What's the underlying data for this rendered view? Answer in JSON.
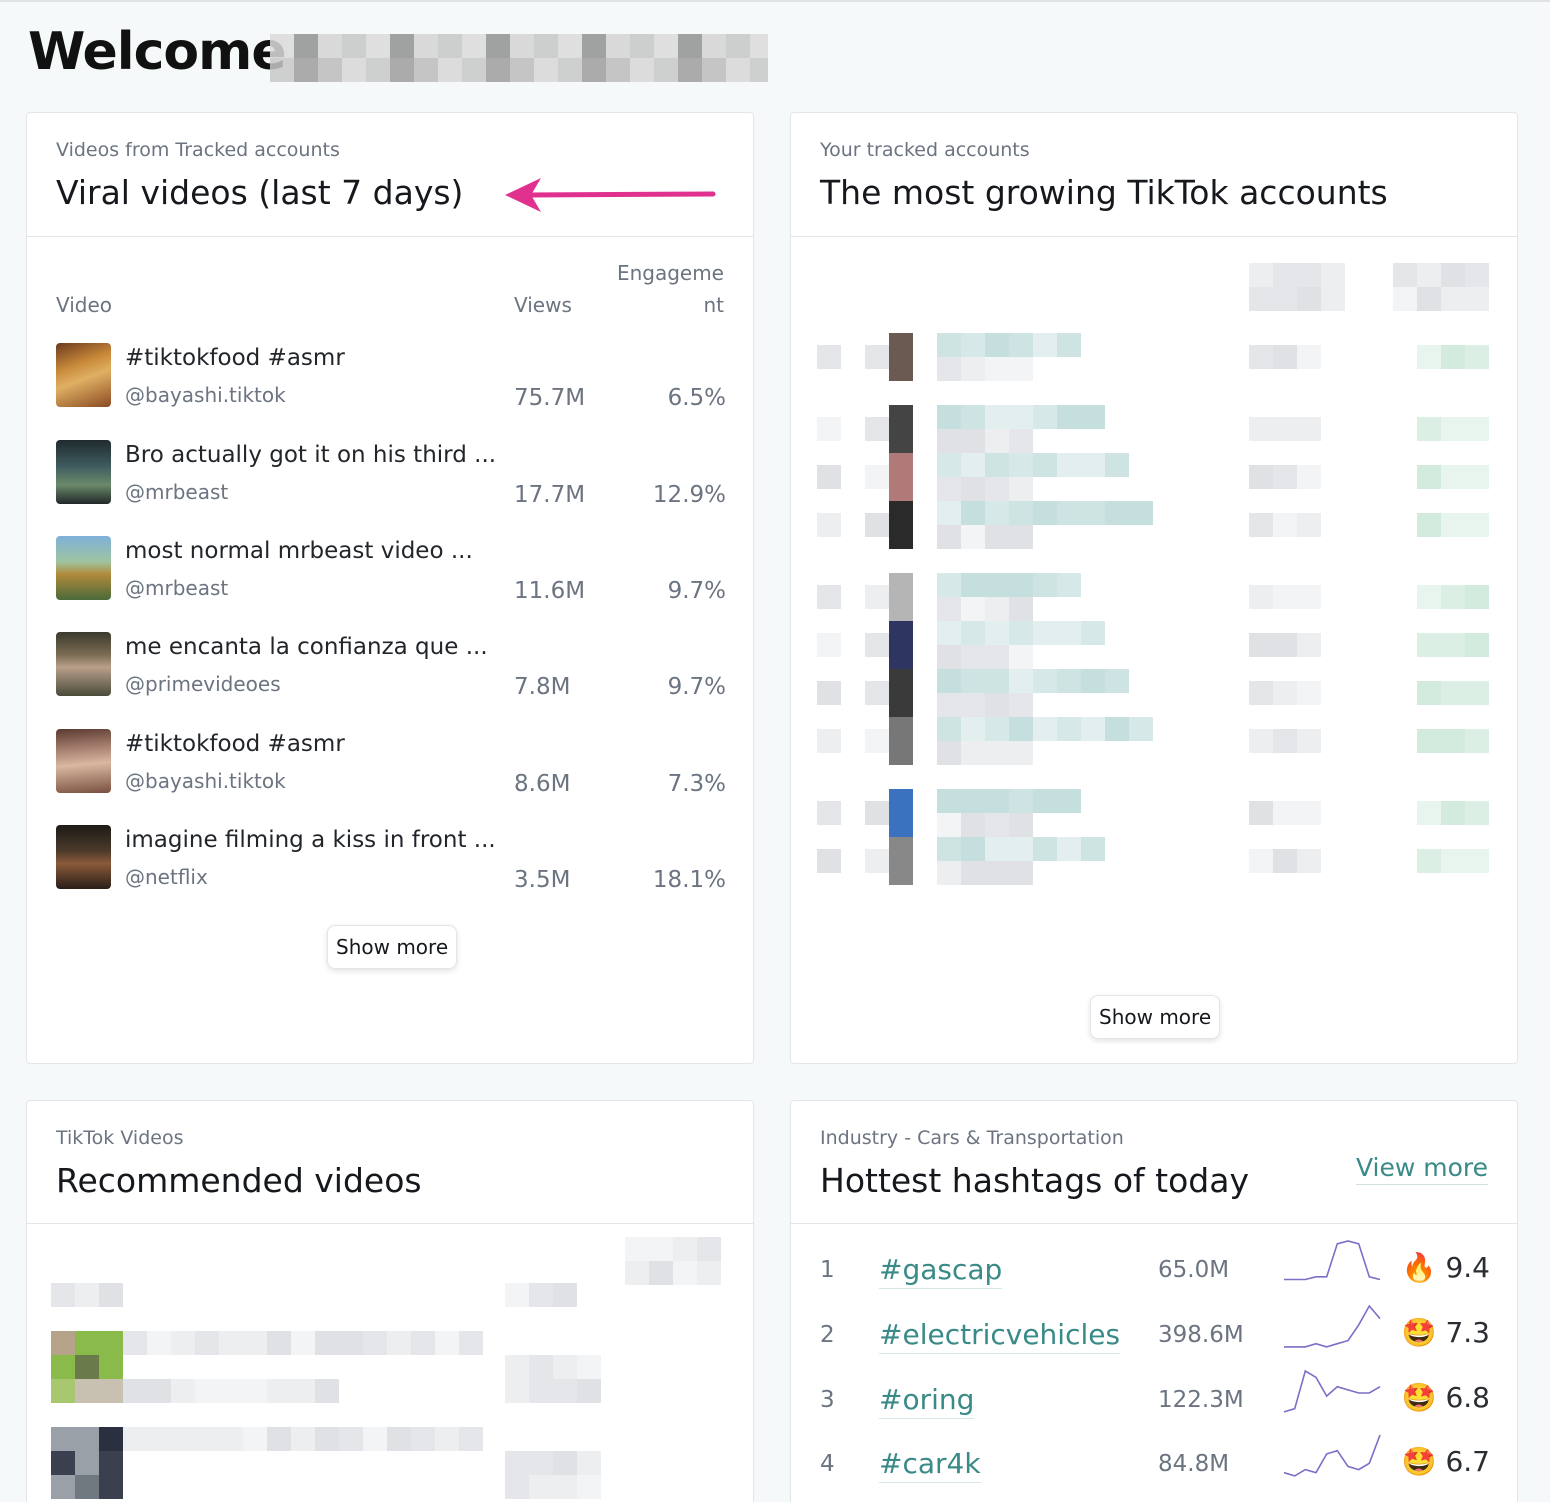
{
  "page": {
    "welcome": "Welcome"
  },
  "viral_card": {
    "eyebrow": "Videos from Tracked accounts",
    "title": "Viral videos (last 7 days)",
    "col_video": "Video",
    "col_views": "Views",
    "col_engagement_line1": "Engageme",
    "col_engagement_line2": "nt",
    "rows": [
      {
        "title": "#tiktokfood #asmr",
        "user": "@bayashi.tiktok",
        "views": "75.7M",
        "engagement": "6.5%"
      },
      {
        "title": "Bro actually got it on his third ...",
        "user": "@mrbeast",
        "views": "17.7M",
        "engagement": "12.9%"
      },
      {
        "title": "most normal mrbeast video ...",
        "user": "@mrbeast",
        "views": "11.6M",
        "engagement": "9.7%"
      },
      {
        "title": "me encanta la confianza que ...",
        "user": "@primevideoes",
        "views": "7.8M",
        "engagement": "9.7%"
      },
      {
        "title": "#tiktokfood #asmr",
        "user": "@bayashi.tiktok",
        "views": "8.6M",
        "engagement": "7.3%"
      },
      {
        "title": "imagine filming a kiss in front ...",
        "user": "@netflix",
        "views": "3.5M",
        "engagement": "18.1%"
      }
    ],
    "show_more": "Show more"
  },
  "growing_card": {
    "eyebrow": "Your tracked accounts",
    "title": "The most growing TikTok accounts",
    "show_more": "Show more"
  },
  "recommended_card": {
    "eyebrow": "TikTok Videos",
    "title": "Recommended videos"
  },
  "hashtags_card": {
    "eyebrow": "Industry - Cars & Transportation",
    "title": "Hottest hashtags of today",
    "view_more": "View more",
    "rows": [
      {
        "rank": "1",
        "tag": "#gascap",
        "views": "65.0M",
        "emoji": "🔥",
        "score": "9.4",
        "trend": [
          2,
          2,
          2,
          3,
          3,
          15,
          16,
          15,
          3,
          2
        ]
      },
      {
        "rank": "2",
        "tag": "#electricvehicles",
        "views": "398.6M",
        "emoji": "🤩",
        "score": "7.3",
        "trend": [
          1,
          1,
          1,
          2,
          1,
          2,
          3,
          8,
          14,
          10
        ]
      },
      {
        "rank": "3",
        "tag": "#oring",
        "views": "122.3M",
        "emoji": "🤩",
        "score": "6.8",
        "trend": [
          1,
          2,
          14,
          12,
          6,
          9,
          8,
          7,
          7,
          9
        ]
      },
      {
        "rank": "4",
        "tag": "#car4k",
        "views": "84.8M",
        "emoji": "🤩",
        "score": "6.7",
        "trend": [
          2,
          1,
          3,
          2,
          8,
          9,
          4,
          3,
          5,
          14
        ]
      }
    ]
  },
  "colors": {
    "accent_teal": "#3a8a87",
    "arrow_pink": "#e0318f",
    "sparkline": "#7b6fc7"
  }
}
